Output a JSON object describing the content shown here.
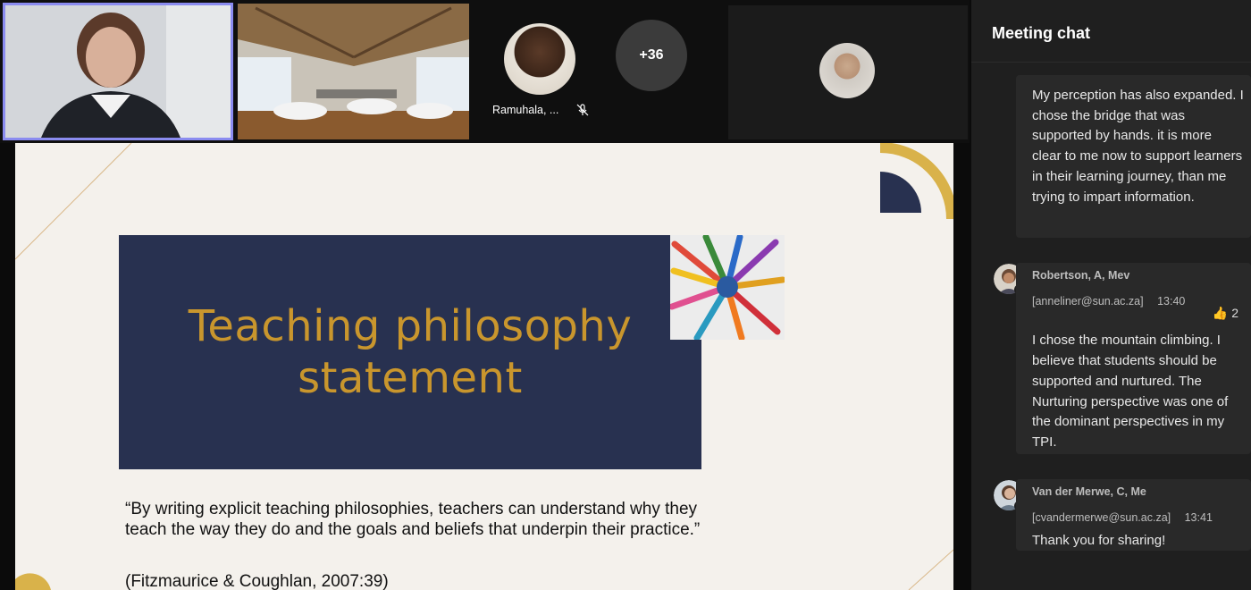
{
  "video": {
    "participant_name": "Ramuhala, ...",
    "overflow_count": "+36"
  },
  "slide": {
    "title_line1": "Teaching philosophy",
    "title_line2": "statement",
    "quote": "“By writing explicit teaching philosophies, teachers can understand why they teach the way they do and the goals and beliefs that underpin their practice.”",
    "citation": "(Fitzmaurice & Coughlan, 2007:39)"
  },
  "chat": {
    "title": "Meeting chat",
    "messages": [
      {
        "text": "My perception has also expanded. I chose the bridge that was supported by hands. it is more clear to me now to support learners in their learning journey, than me trying to impart information."
      },
      {
        "sender": "Robertson, A, Mev",
        "email": "[anneliner@sun.ac.za]",
        "time": "13:40",
        "reaction_count": "2",
        "text": "I chose the mountain climbing. I believe that students should be supported and nurtured. The Nurturing perspective was one of the dominant perspectives in my TPI."
      },
      {
        "sender": "Van der Merwe, C, Me",
        "email": "[cvandermerwe@sun.ac.za]",
        "time": "13:41",
        "text": "Thank you for sharing!"
      }
    ]
  },
  "colors": {
    "active_speaker_border": "#8b8cf0",
    "slide_title_bg": "#283150",
    "slide_title_text": "#c9962d",
    "presence_busy": "#c4314b"
  }
}
